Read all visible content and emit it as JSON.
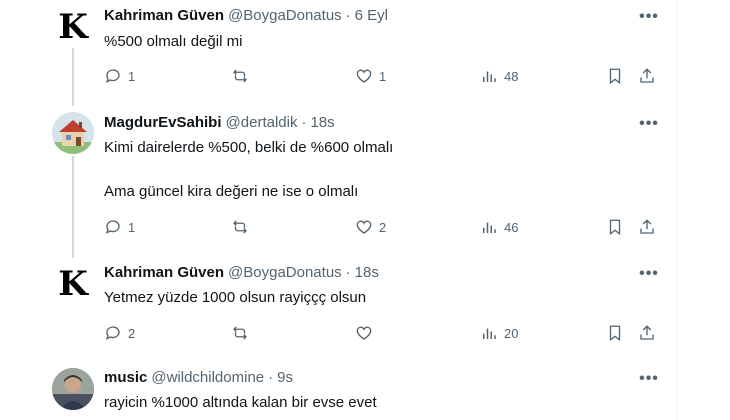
{
  "tweets": [
    {
      "display_name": "Kahriman Güven",
      "handle": "@BoygaDonatus",
      "time": "6 Eyl",
      "avatar_letter": "K",
      "text_lines": [
        "%500 olmalı değil mi"
      ],
      "reply_count": "1",
      "retweet_count": "",
      "like_count": "1",
      "view_count": "48"
    },
    {
      "display_name": "MagdurEvSahibi",
      "handle": "@dertaldik",
      "time": "18s",
      "avatar_icon": "house-avatar",
      "text_lines": [
        "Kimi dairelerde %500, belki de %600 olmalı",
        "Ama güncel kira değeri ne ise o olmalı"
      ],
      "reply_count": "1",
      "retweet_count": "",
      "like_count": "2",
      "view_count": "46"
    },
    {
      "display_name": "Kahriman Güven",
      "handle": "@BoygaDonatus",
      "time": "18s",
      "avatar_letter": "K",
      "text_lines": [
        "Yetmez yüzde 1000 olsun rayiççç olsun"
      ],
      "reply_count": "2",
      "retweet_count": "",
      "like_count": "",
      "view_count": "20"
    },
    {
      "display_name": "music",
      "handle": "@wildchildomine",
      "time": "9s",
      "avatar_icon": "photo-avatar",
      "text_lines": [
        "rayicin %1000 altında kalan bir evse evet"
      ]
    }
  ],
  "separator": "·",
  "more_glyph": "•••",
  "colors": {
    "text_primary": "#0f1419",
    "text_secondary": "#536471",
    "thread_line": "#cfd9de"
  }
}
